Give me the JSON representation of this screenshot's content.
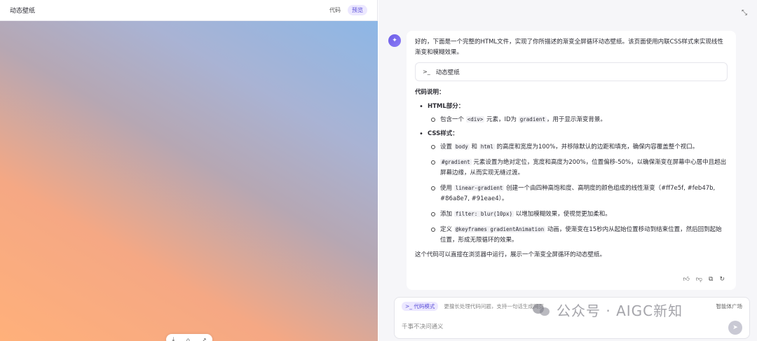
{
  "left": {
    "title": "动态壁纸",
    "tabs": [
      {
        "label": "代码"
      },
      {
        "label": "预览"
      }
    ]
  },
  "icons": {
    "expand": "expand-icon",
    "avatar": "assistant-logo-icon",
    "file": "terminal-icon",
    "actions": [
      "thumbs-up-icon",
      "thumbs-down-icon",
      "copy-icon",
      "regenerate-icon"
    ],
    "send": "send-icon"
  },
  "message": {
    "intro": "好的，下面是一个完整的HTML文件，实现了你所描述的渐变全屏循环动态壁纸。该页面使用内联CSS样式来实现线性渐变和模糊效果。",
    "file_name": "动态壁纸",
    "section_title": "代码说明：",
    "html_title": "HTML部分：",
    "html_item_pre": "包含一个",
    "html_item_code1": "<div>",
    "html_item_mid": "元素，ID为",
    "html_item_code2": "gradient",
    "html_item_post": "，用于显示渐变背景。",
    "css_title": "CSS样式：",
    "css1_pre": "设置",
    "css1_code1": "body",
    "css1_mid": "和",
    "css1_code2": "html",
    "css1_post": "的高度和宽度为100%，并移除默认的边距和填充，确保内容覆盖整个视口。",
    "css2_code": "#gradient",
    "css2_post": "元素设置为绝对定位，宽度和高度为200%，位置偏移-50%，以确保渐变在屏幕中心居中且超出屏幕边缘，从而实现无缝过渡。",
    "css3_pre": "使用",
    "css3_code": "linear-gradient",
    "css3_post": "创建一个由四种高饱和度、高明度的颜色组成的线性渐变（#ff7e5f, #feb47b, #86a8e7, #91eae4）。",
    "css4_pre": "添加",
    "css4_code": "filter: blur(10px)",
    "css4_post": "以增加模糊效果，使视觉更加柔和。",
    "css5_pre": "定义",
    "css5_code": "@keyframes gradientAnimation",
    "css5_post": "动画，使渐变在15秒内从起始位置移动到结束位置，然后回到起始位置，形成无限循环的效果。",
    "closing": "这个代码可以直接在浏览器中运行，展示一个渐变全屏循环的动态壁纸。"
  },
  "input": {
    "mode_label": "代码模式",
    "mode_hint": "更擅长处理代码问题，支持一句话生成网页",
    "square_label": "智能体广场",
    "placeholder": "千事不决问通义"
  },
  "watermark": {
    "text": "公众号 · AIGC新知"
  },
  "colors": {
    "accent": "#5b4fd8",
    "gradient": [
      "#ffb07a",
      "#b6a7b3",
      "#8db7e6"
    ]
  }
}
